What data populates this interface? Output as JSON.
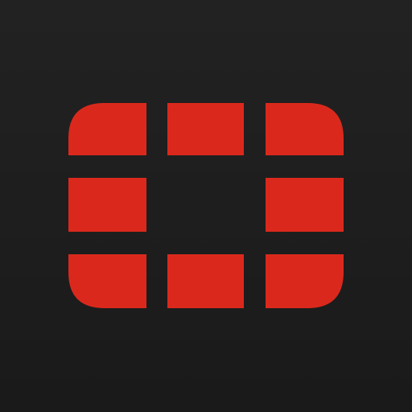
{
  "icon": {
    "name": "fortinet-logo-icon",
    "brand_color": "#DA291C",
    "background_color": "#1C1C1C"
  }
}
